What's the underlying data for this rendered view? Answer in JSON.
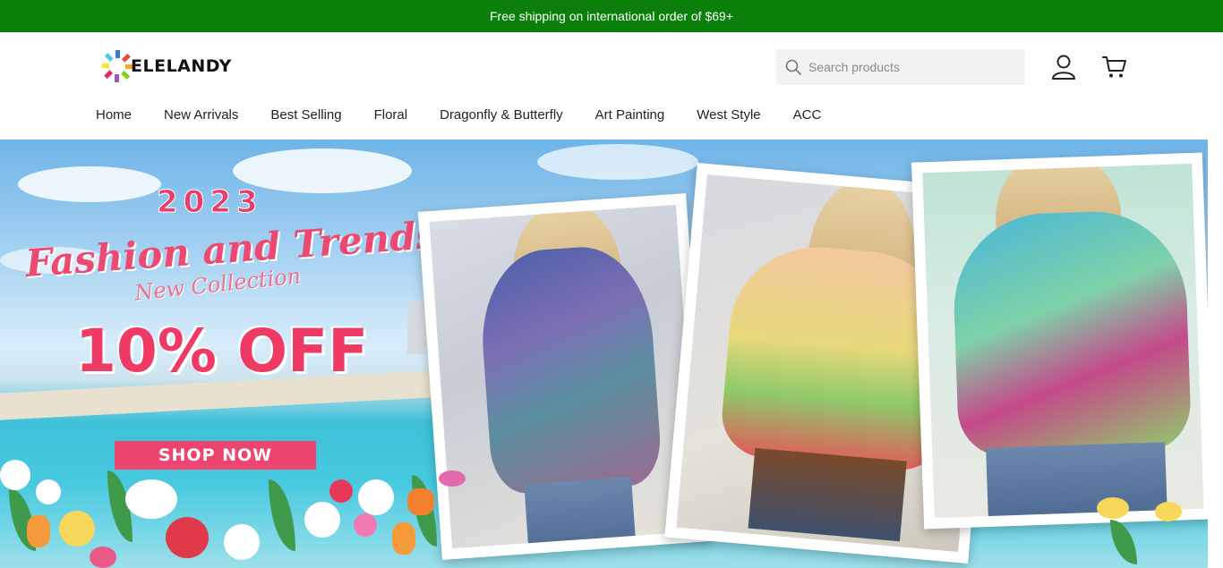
{
  "announcement": {
    "text": "Free shipping on international order of $69+"
  },
  "colors": {
    "announcement_bg": "#0a800a",
    "accent_pink": "#ee4470"
  },
  "header": {
    "logo_text": "ELELANDY",
    "search": {
      "placeholder": "Search products",
      "icon": "search-icon"
    },
    "account_icon": "user-icon",
    "cart_icon": "cart-icon"
  },
  "nav": {
    "items": [
      {
        "label": "Home"
      },
      {
        "label": "New Arrivals"
      },
      {
        "label": "Best Selling"
      },
      {
        "label": "Floral"
      },
      {
        "label": "Dragonfly & Butterfly"
      },
      {
        "label": "Art Painting"
      },
      {
        "label": "West Style"
      },
      {
        "label": "ACC"
      }
    ]
  },
  "hero": {
    "year": "2023",
    "title": "Fashion and Trends",
    "subtitle": "New Collection",
    "offer": "10% OFF",
    "cta_label": "SHOP NOW"
  }
}
